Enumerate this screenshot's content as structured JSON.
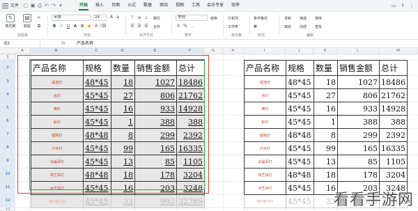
{
  "menubar": {
    "file_label": "文件",
    "tabs": [
      "开始",
      "插入",
      "页面",
      "公式",
      "数据",
      "审阅",
      "视图",
      "工具",
      "会员专享",
      "效率"
    ],
    "active_tab": "开始"
  },
  "ribbon": {
    "format_painter": "格式刷",
    "paste": "粘贴",
    "font_name": "宋体",
    "font_size": "24",
    "wrap_text": "换行",
    "merge": "合并",
    "number_format": "常规",
    "convert": "转换",
    "row_col": "行和列",
    "worksheet": "工作表",
    "cond_format": "条件格式",
    "fill": "填充",
    "sort": "排序",
    "freeze": "冻结",
    "find": "查找",
    "sum": "求和",
    "filter": "筛选",
    "groups": [
      "剪贴板",
      "字体",
      "对齐方式",
      "数字",
      "单元格",
      "样式",
      "编辑"
    ]
  },
  "formula_bar": {
    "cell_ref": "B3",
    "fx": "fx",
    "content": "产品名称"
  },
  "columns": [
    "A",
    "B",
    "C",
    "D",
    "E",
    "F",
    "G",
    "H",
    "I",
    "J",
    "K",
    "L",
    "M"
  ],
  "rows": [
    "1",
    "2",
    "3",
    "4",
    "5",
    "6",
    "7",
    "8",
    "9",
    "10",
    "11",
    "12",
    "13"
  ],
  "table": {
    "headers": [
      "产品名称",
      "规格",
      "数量",
      "销售金额",
      "总计"
    ],
    "rows": [
      [
        "铝泡灯",
        "48*45",
        "18",
        "1027",
        "18486"
      ],
      [
        "台灯",
        "45*45",
        "27",
        "806",
        "21762"
      ],
      [
        "黄灯",
        "45*45",
        "16",
        "933",
        "14928"
      ],
      [
        "彩灯",
        "45*45",
        "1",
        "388",
        "388"
      ],
      [
        "庭院灯",
        "48*48",
        "8",
        "299",
        "2392"
      ],
      [
        "户外灯",
        "45*45",
        "99",
        "165",
        "16335"
      ],
      [
        "水晶吊灯",
        "45*45",
        "13",
        "85",
        "1105"
      ],
      [
        "铁艺吊灯",
        "48*48",
        "18",
        "178",
        "3204"
      ],
      [
        "木艺吊灯",
        "45*45",
        "16",
        "203",
        "3248"
      ],
      [
        "简约吸顶灯",
        "45*45",
        "33",
        "993",
        "32769"
      ]
    ]
  },
  "watermark": "看看手游网"
}
